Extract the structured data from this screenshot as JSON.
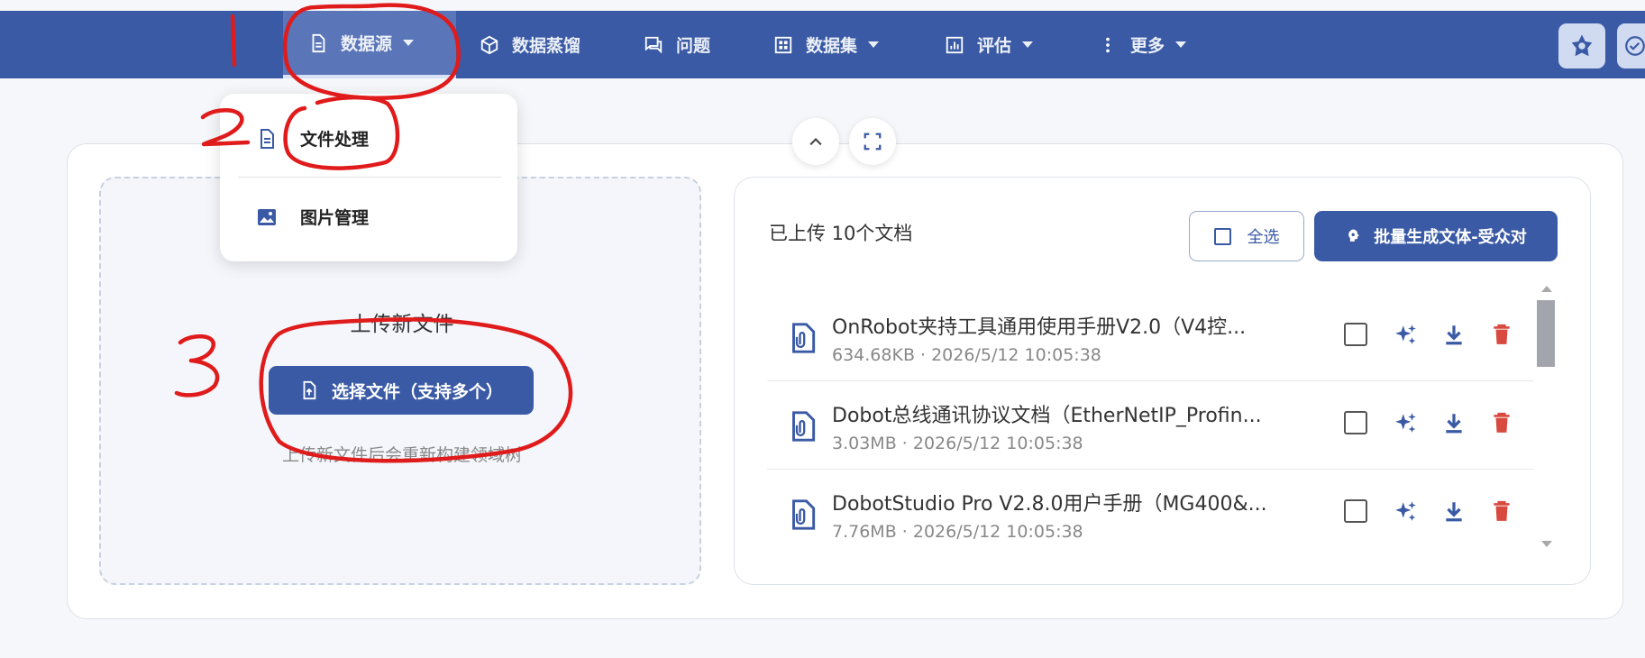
{
  "nav": {
    "items": [
      {
        "label": "数据源",
        "icon": "document-icon",
        "active": true
      },
      {
        "label": "数据蒸馏",
        "icon": "cube-icon"
      },
      {
        "label": "问题",
        "icon": "chat-icon"
      },
      {
        "label": "数据集",
        "icon": "grid-icon"
      },
      {
        "label": "评估",
        "icon": "bar-chart-icon"
      },
      {
        "label": "更多",
        "icon": "more-vertical-icon"
      }
    ]
  },
  "dropdown": {
    "items": [
      {
        "label": "文件处理",
        "icon": "document-icon"
      },
      {
        "label": "图片管理",
        "icon": "image-icon"
      }
    ]
  },
  "upload": {
    "title": "上传新文件",
    "button_label": "选择文件（支持多个）",
    "hint": "上传新文件后会重新构建领域树"
  },
  "file_list": {
    "title": "已上传 10个文档",
    "select_all_label": "全选",
    "batch_label": "批量生成文体-受众对",
    "files": [
      {
        "name": "OnRobot夹持工具通用使用手册V2.0（V4控...",
        "size": "634.68KB",
        "time": "2026/5/12 10:05:38",
        "meta": "634.68KB · 2026/5/12 10:05:38"
      },
      {
        "name": "Dobot总线通讯协议文档（EtherNetIP_Profin...",
        "size": "3.03MB",
        "time": "2026/5/12 10:05:38",
        "meta": "3.03MB · 2026/5/12 10:05:38"
      },
      {
        "name": "DobotStudio Pro V2.8.0用户手册（MG400&...",
        "size": "7.76MB",
        "time": "2026/5/12 10:05:38",
        "meta": "7.76MB · 2026/5/12 10:05:38"
      }
    ]
  },
  "annotations": [
    "1",
    "2",
    "3"
  ],
  "colors": {
    "primary": "#3a5aa5",
    "nav_active": "#5a76b9",
    "delete": "#d84a3f",
    "annotation": "#e01b1b"
  }
}
